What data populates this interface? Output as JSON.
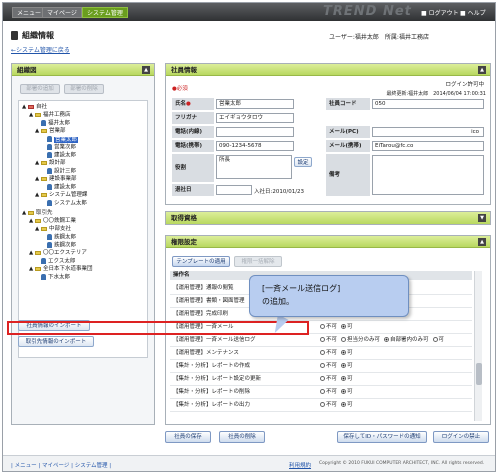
{
  "topbar": {
    "tabs": [
      "メニュー",
      "マイページ",
      "システム管理"
    ],
    "brand": "TREND Net",
    "logout": "ログアウト",
    "help": "ヘルプ"
  },
  "page": {
    "title": "組織情報",
    "user": "ユーザー:福井太郎",
    "dept": "所属:福井工務店",
    "back": "←システム管理に戻る"
  },
  "left": {
    "title": "組織図",
    "btn_add": "部署の追加",
    "btn_del": "部署の削除",
    "tree": [
      "自社",
      "福井工務店",
      "福井太郎",
      "営業部",
      "営業太郎",
      "営業次郎",
      "建設太郎",
      "設計部",
      "設計三郎",
      "建設事業部",
      "建設太郎",
      "システム管理課",
      "システム太郎",
      "取引先",
      "〇〇鉄鋼工業",
      "中部支社",
      "鉄鋼太郎",
      "鉄鋼次郎",
      "〇〇エクステリア",
      "エクス太郎",
      "全日本下水道事業団",
      "下水太郎"
    ],
    "import_staff": "社員情報のインポート",
    "import_client": "取引先情報のインポート"
  },
  "staff": {
    "title": "社員情報",
    "loggedin": "ログイン許可中",
    "required": "●必須",
    "lastupd": "最終更新:福井太郎　2014/06/04 17:00:31",
    "labels": [
      "氏名",
      "フリガナ",
      "電話(内線)",
      "電話(携帯)",
      "役割",
      "退社日",
      "社員コード",
      "メール(PC)",
      "メール(携帯)",
      "備考"
    ],
    "name": "営業太郎",
    "kana": "エイギョウタロウ",
    "tel_ext": "",
    "tel_mobile": "090-1234-5678",
    "role": "所長",
    "role_btn": "設定",
    "retire": "",
    "join_note": "入社日:2010/01/23",
    "code": "050",
    "mail_pc": "ico",
    "mail_mobile": "EiTarou@fc.co"
  },
  "skill": {
    "title": "取得資格"
  },
  "auth": {
    "title": "権限設定",
    "tpl_btn": "テンプレートの適用",
    "tpl_btn2": "権限一括解除",
    "col": "操作名",
    "rows": [
      {
        "name": "【運用管理】通報の閲覧",
        "opts": []
      },
      {
        "name": "【運用管理】書類・図面管理",
        "opts": []
      },
      {
        "name": "【運用管理】完成印刷",
        "opts": []
      },
      {
        "name": "【運用管理】一斉メール",
        "opts": [
          "不可",
          "可"
        ],
        "sel": 1
      },
      {
        "name": "【運用管理】一斉メール送信ログ",
        "opts": [
          "不可",
          "担当分のみ可",
          "自部署内のみ可",
          "可"
        ],
        "sel": 2
      },
      {
        "name": "【運用管理】メンテナンス",
        "opts": [
          "不可",
          "可"
        ],
        "sel": 1
      },
      {
        "name": "【集計・分析】レポートの作成",
        "opts": [
          "不可",
          "可"
        ],
        "sel": 1
      },
      {
        "name": "【集計・分析】レポート設定の更新",
        "opts": [
          "不可",
          "可"
        ],
        "sel": 1
      },
      {
        "name": "【集計・分析】レポートの削除",
        "opts": [
          "不可",
          "可"
        ],
        "sel": 1
      },
      {
        "name": "【集計・分析】レポートの出力",
        "opts": [
          "不可",
          "可"
        ],
        "sel": 1
      }
    ]
  },
  "callout": {
    "line1": "[一斉メール送信ログ]",
    "line2": "の追加。"
  },
  "bottom": {
    "save": "社員の保存",
    "delete": "社員の削除",
    "notify": "保存してID・パスワードの通知",
    "stop": "ログインの禁止"
  },
  "footer": {
    "links": "| メニュー | マイページ | システム管理 |",
    "privacy": "利用規約",
    "copy": "Copyright © 2010 FUKUI COMPUTER ARCHITECT, INC. All rights reserved."
  }
}
